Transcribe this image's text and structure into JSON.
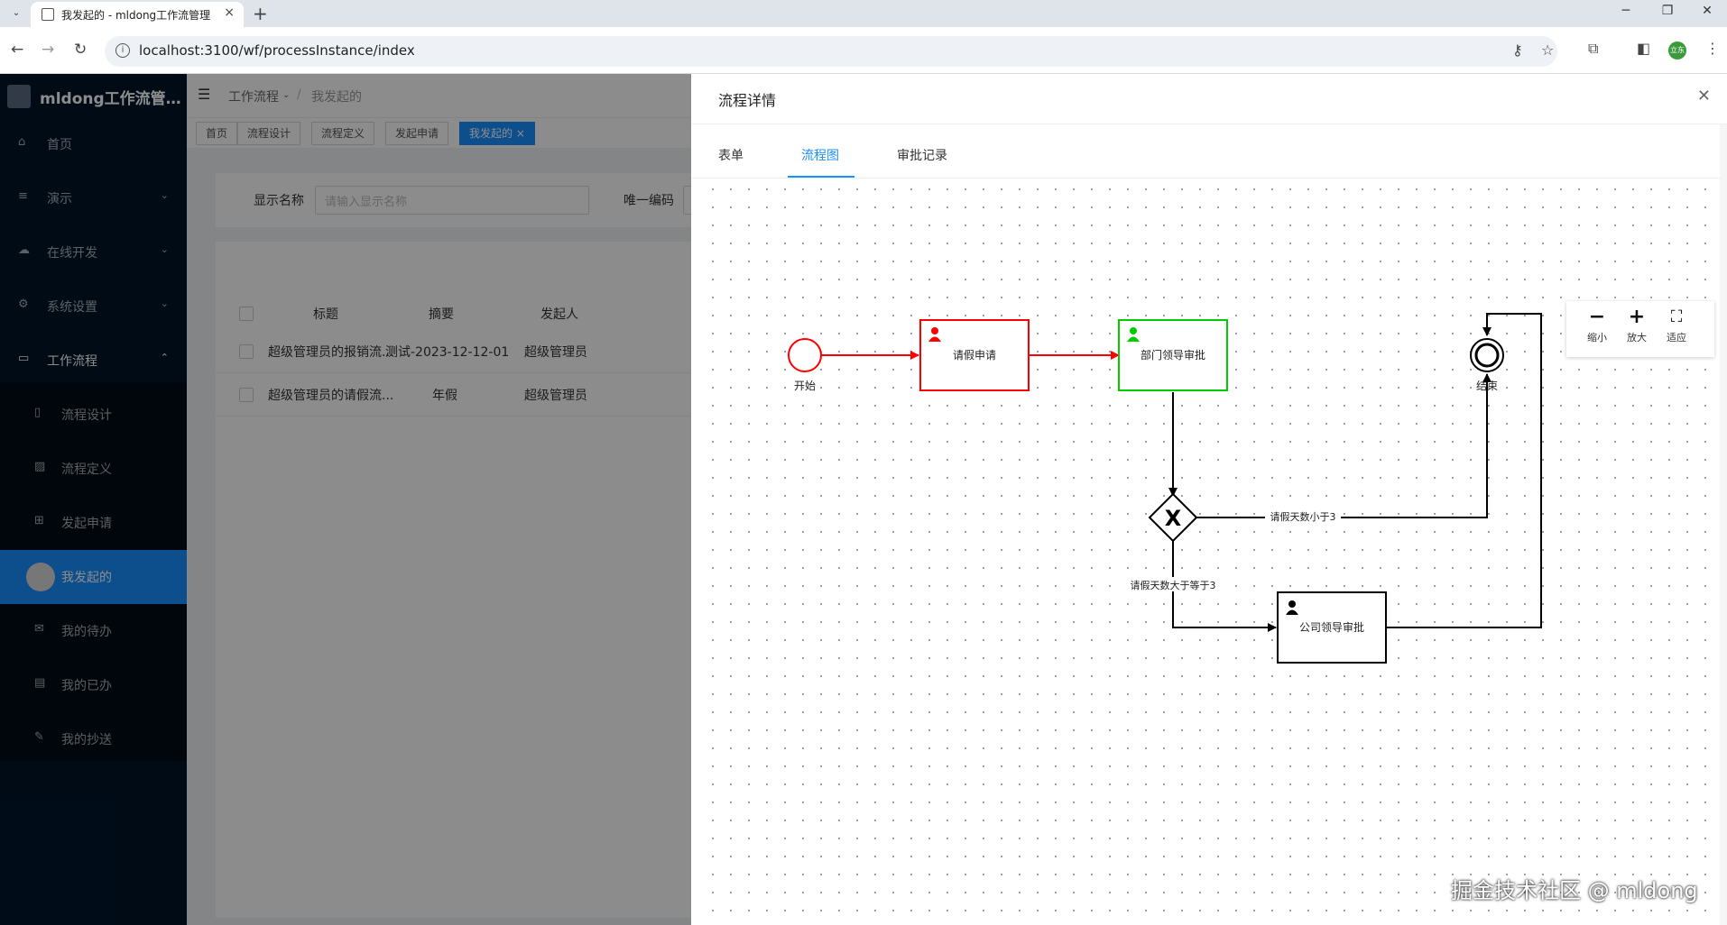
{
  "browser": {
    "tab_title": "我发起的 - mldong工作流管理",
    "url": "localhost:3100/wf/processInstance/index",
    "profile_label": "立东"
  },
  "sidebar": {
    "logo_text": "mldong工作流管理...",
    "items": [
      {
        "label": "首页",
        "icon": "home-icon"
      },
      {
        "label": "演示",
        "icon": "menu-icon"
      },
      {
        "label": "在线开发",
        "icon": "cloud-icon"
      },
      {
        "label": "系统设置",
        "icon": "gear-icon"
      },
      {
        "label": "工作流程",
        "icon": "monitor-icon"
      }
    ],
    "subitems": [
      {
        "label": "流程设计",
        "icon": "file-icon"
      },
      {
        "label": "流程定义",
        "icon": "image-icon"
      },
      {
        "label": "发起申请",
        "icon": "grid-icon"
      },
      {
        "label": "我发起的",
        "icon": "avatar"
      },
      {
        "label": "我的待办",
        "icon": "mail-icon"
      },
      {
        "label": "我的已办",
        "icon": "book-icon"
      },
      {
        "label": "我的抄送",
        "icon": "edit-icon"
      }
    ]
  },
  "header": {
    "breadcrumb": [
      "工作流程",
      "我发起的"
    ]
  },
  "tags": [
    "首页",
    "流程设计",
    "流程定义",
    "发起申请",
    "我发起的"
  ],
  "search": {
    "name_label": "显示名称",
    "name_placeholder": "请输入显示名称",
    "code_label": "唯一编码"
  },
  "table": {
    "columns": [
      "标题",
      "摘要",
      "发起人"
    ],
    "rows": [
      [
        "超级管理员的报销流...",
        "测试-2023-12-12-01",
        "超级管理员"
      ],
      [
        "超级管理员的请假流...",
        "年假",
        "超级管理员"
      ]
    ]
  },
  "drawer": {
    "title": "流程详情",
    "tabs": [
      "表单",
      "流程图",
      "审批记录"
    ],
    "active_tab": "流程图"
  },
  "toolbox": {
    "zoom_out": "缩小",
    "zoom_in": "放大",
    "fit": "适应"
  },
  "diagram": {
    "start_label": "开始",
    "end_label": "结束",
    "task1": "请假申请",
    "task2": "部门领导审批",
    "task3": "公司领导审批",
    "cond_lt": "请假天数小于3",
    "cond_ge": "请假天数大于等于3",
    "colors": {
      "done": "#ff0000",
      "active": "#00cc00",
      "pending": "#000000"
    }
  },
  "watermark": "掘金技术社区 @ mldong"
}
